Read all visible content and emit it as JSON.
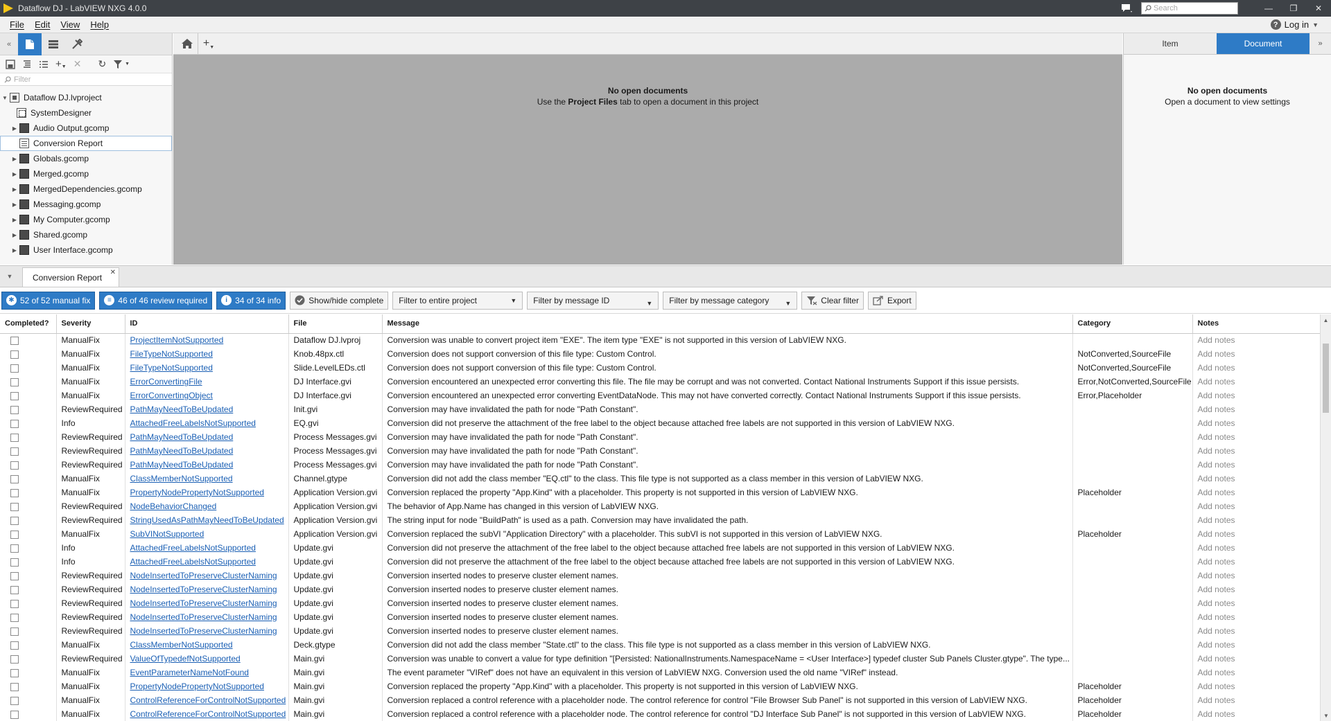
{
  "window": {
    "title": "Dataflow DJ - LabVIEW NXG 4.0.0",
    "search_placeholder": "Search",
    "minimize": "—",
    "restore": "❐",
    "close": "✕"
  },
  "menu": {
    "items": [
      "File",
      "Edit",
      "View",
      "Help"
    ],
    "login_label": "Log in"
  },
  "left_panel": {
    "filter_placeholder": "Filter",
    "tree": [
      {
        "label": "Dataflow DJ.lvproject",
        "icon": "project-icon"
      },
      {
        "label": "SystemDesigner",
        "icon": "system-designer-icon"
      },
      {
        "label": "Audio Output.gcomp",
        "icon": "component-icon"
      },
      {
        "label": "Conversion Report",
        "icon": "report-icon",
        "selected": true
      },
      {
        "label": "Globals.gcomp",
        "icon": "component-icon"
      },
      {
        "label": "Merged.gcomp",
        "icon": "component-icon"
      },
      {
        "label": "MergedDependencies.gcomp",
        "icon": "component-icon"
      },
      {
        "label": "Messaging.gcomp",
        "icon": "component-icon"
      },
      {
        "label": "My Computer.gcomp",
        "icon": "component-icon"
      },
      {
        "label": "Shared.gcomp",
        "icon": "component-icon"
      },
      {
        "label": "User Interface.gcomp",
        "icon": "component-icon"
      }
    ]
  },
  "document_area": {
    "empty_title": "No open documents",
    "empty_pre": "Use the ",
    "empty_bold": "Project Files",
    "empty_post": " tab to open a document in this project"
  },
  "right_panel": {
    "tab_item": "Item",
    "tab_document": "Document",
    "empty_title": "No open documents",
    "empty_sub": "Open a document to view settings"
  },
  "bottom_panel": {
    "tab_label": "Conversion Report",
    "toolbar": {
      "manual_fix": "52 of 52 manual fix",
      "review_required": "46 of 46 review required",
      "info": "34 of 34 info",
      "show_hide": "Show/hide complete",
      "filter_project": "Filter to entire project",
      "filter_message_id": "Filter by message ID",
      "filter_category": "Filter by message category",
      "clear_filter": "Clear filter",
      "export": "Export"
    },
    "columns": [
      "Completed?",
      "Severity",
      "ID",
      "File",
      "Message",
      "Category",
      "Notes"
    ],
    "notes_placeholder": "Add notes",
    "rows": [
      [
        "ManualFix",
        "ProjectItemNotSupported",
        "Dataflow DJ.lvproj",
        "Conversion was unable to convert project item \"EXE\". The item type \"EXE\" is not supported in this version of LabVIEW NXG.",
        ""
      ],
      [
        "ManualFix",
        "FileTypeNotSupported",
        "Knob.48px.ctl",
        "Conversion does not support conversion of this file type: Custom Control.",
        "NotConverted,SourceFile"
      ],
      [
        "ManualFix",
        "FileTypeNotSupported",
        "Slide.LevelLEDs.ctl",
        "Conversion does not support conversion of this file type: Custom Control.",
        "NotConverted,SourceFile"
      ],
      [
        "ManualFix",
        "ErrorConvertingFile",
        "DJ Interface.gvi",
        "Conversion encountered an unexpected error converting this file. The file may be corrupt and was not converted. Contact National Instruments Support if this issue persists.",
        "Error,NotConverted,SourceFile"
      ],
      [
        "ManualFix",
        "ErrorConvertingObject",
        "DJ Interface.gvi",
        "Conversion encountered an unexpected error converting EventDataNode. This may not have converted correctly. Contact National Instruments Support if this issue persists.",
        "Error,Placeholder"
      ],
      [
        "ReviewRequired",
        "PathMayNeedToBeUpdated",
        "Init.gvi",
        "Conversion may have invalidated the path for node \"Path Constant\".",
        ""
      ],
      [
        "Info",
        "AttachedFreeLabelsNotSupported",
        "EQ.gvi",
        "Conversion did not preserve the attachment of the free label to the object because attached free labels are not supported in this version of LabVIEW NXG.",
        ""
      ],
      [
        "ReviewRequired",
        "PathMayNeedToBeUpdated",
        "Process Messages.gvi",
        "Conversion may have invalidated the path for node \"Path Constant\".",
        ""
      ],
      [
        "ReviewRequired",
        "PathMayNeedToBeUpdated",
        "Process Messages.gvi",
        "Conversion may have invalidated the path for node \"Path Constant\".",
        ""
      ],
      [
        "ReviewRequired",
        "PathMayNeedToBeUpdated",
        "Process Messages.gvi",
        "Conversion may have invalidated the path for node \"Path Constant\".",
        ""
      ],
      [
        "ManualFix",
        "ClassMemberNotSupported",
        "Channel.gtype",
        "Conversion did not add the class member \"EQ.ctl\" to the class. This file type is not supported as a class member in this version of LabVIEW NXG.",
        ""
      ],
      [
        "ManualFix",
        "PropertyNodePropertyNotSupported",
        "Application Version.gvi",
        "Conversion replaced the property \"App.Kind\" with a placeholder. This property is not supported in this version of LabVIEW NXG.",
        "Placeholder"
      ],
      [
        "ReviewRequired",
        "NodeBehaviorChanged",
        "Application Version.gvi",
        "The behavior of App.Name has changed in this version of LabVIEW NXG.",
        ""
      ],
      [
        "ReviewRequired",
        "StringUsedAsPathMayNeedToBeUpdated",
        "Application Version.gvi",
        "The string input for node \"BuildPath\" is used as a path. Conversion may have invalidated the path.",
        ""
      ],
      [
        "ManualFix",
        "SubVINotSupported",
        "Application Version.gvi",
        "Conversion replaced the subVI \"Application Directory\" with a placeholder. This subVI is not supported in this version of LabVIEW NXG.",
        "Placeholder"
      ],
      [
        "Info",
        "AttachedFreeLabelsNotSupported",
        "Update.gvi",
        "Conversion did not preserve the attachment of the free label to the object because attached free labels are not supported in this version of LabVIEW NXG.",
        ""
      ],
      [
        "Info",
        "AttachedFreeLabelsNotSupported",
        "Update.gvi",
        "Conversion did not preserve the attachment of the free label to the object because attached free labels are not supported in this version of LabVIEW NXG.",
        ""
      ],
      [
        "ReviewRequired",
        "NodeInsertedToPreserveClusterNaming",
        "Update.gvi",
        "Conversion inserted nodes to preserve cluster element names.",
        ""
      ],
      [
        "ReviewRequired",
        "NodeInsertedToPreserveClusterNaming",
        "Update.gvi",
        "Conversion inserted nodes to preserve cluster element names.",
        ""
      ],
      [
        "ReviewRequired",
        "NodeInsertedToPreserveClusterNaming",
        "Update.gvi",
        "Conversion inserted nodes to preserve cluster element names.",
        ""
      ],
      [
        "ReviewRequired",
        "NodeInsertedToPreserveClusterNaming",
        "Update.gvi",
        "Conversion inserted nodes to preserve cluster element names.",
        ""
      ],
      [
        "ReviewRequired",
        "NodeInsertedToPreserveClusterNaming",
        "Update.gvi",
        "Conversion inserted nodes to preserve cluster element names.",
        ""
      ],
      [
        "ManualFix",
        "ClassMemberNotSupported",
        "Deck.gtype",
        "Conversion did not add the class member \"State.ctl\" to the class. This file type is not supported as a class member in this version of LabVIEW NXG.",
        ""
      ],
      [
        "ReviewRequired",
        "ValueOfTypedefNotSupported",
        "Main.gvi",
        "Conversion was unable to convert a value for type definition \"[Persisted: NationalInstruments.NamespaceName = <User Interface>] typedef cluster Sub Panels Cluster.gtype\". The type...",
        ""
      ],
      [
        "ManualFix",
        "EventParameterNameNotFound",
        "Main.gvi",
        "The event parameter \"VIRef\" does not have an equivalent in this version of LabVIEW NXG. Conversion used the old name \"VIRef\" instead.",
        ""
      ],
      [
        "ManualFix",
        "PropertyNodePropertyNotSupported",
        "Main.gvi",
        "Conversion replaced the property \"App.Kind\" with a placeholder. This property is not supported in this version of LabVIEW NXG.",
        "Placeholder"
      ],
      [
        "ManualFix",
        "ControlReferenceForControlNotSupported",
        "Main.gvi",
        "Conversion replaced a control reference with a placeholder node. The control reference for control \"File Browser Sub Panel\" is not supported in this version of LabVIEW NXG.",
        "Placeholder"
      ],
      [
        "ManualFix",
        "ControlReferenceForControlNotSupported",
        "Main.gvi",
        "Conversion replaced a control reference with a placeholder node. The control reference for control \"DJ Interface Sub Panel\" is not supported in this version of LabVIEW NXG.",
        "Placeholder"
      ]
    ]
  }
}
